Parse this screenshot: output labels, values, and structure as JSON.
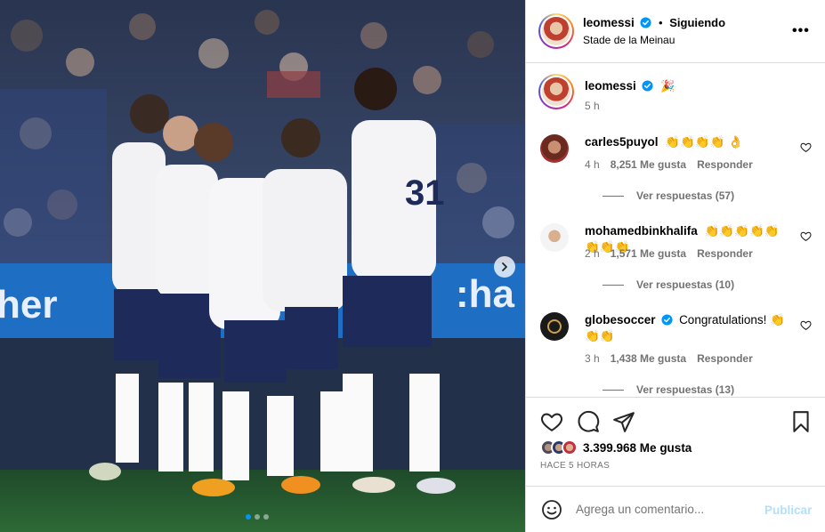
{
  "post": {
    "username": "leomessi",
    "separator": "•",
    "follow_status": "Siguiendo",
    "location": "Stade de la Meinau",
    "more_label": "•••"
  },
  "caption": {
    "username": "leomessi",
    "text": "🎉",
    "time": "5 h"
  },
  "comments": [
    {
      "username": "carles5puyol",
      "text": "👏👏👏👏 👌",
      "time": "4 h",
      "likes": "8,251 Me gusta",
      "reply_label": "Responder",
      "view_replies": "Ver respuestas (57)"
    },
    {
      "username": "mohamedbinkhalifa",
      "text": "👏👏👏👏👏👏👏👏",
      "time": "2 h",
      "likes": "1,571 Me gusta",
      "reply_label": "Responder",
      "view_replies": "Ver respuestas (10)"
    },
    {
      "username": "globesoccer",
      "text": "Congratulations! 👏👏👏",
      "time": "3 h",
      "likes": "1,438 Me gusta",
      "reply_label": "Responder",
      "view_replies": "Ver respuestas (13)"
    }
  ],
  "engagement": {
    "likes": "3.399.968 Me gusta",
    "timestamp": "HACE 5 HORAS"
  },
  "composer": {
    "placeholder": "Agrega un comentario...",
    "publish_label": "Publicar"
  },
  "photo": {
    "banner_text_left": "her",
    "banner_text_right": ":ha",
    "jersey_number": "31",
    "carousel_dots": 3,
    "active_dot": 1
  },
  "colors": {
    "link_blue": "#0095f6",
    "publish_disabled": "#b2dffc",
    "verified_blue": "#0095f6",
    "border": "#dbdbdb",
    "muted_text": "#737373"
  },
  "icons": [
    "verified-icon",
    "more-icon",
    "heart-icon",
    "comment-icon",
    "share-icon",
    "bookmark-icon",
    "emoji-icon",
    "chevron-right-icon"
  ]
}
